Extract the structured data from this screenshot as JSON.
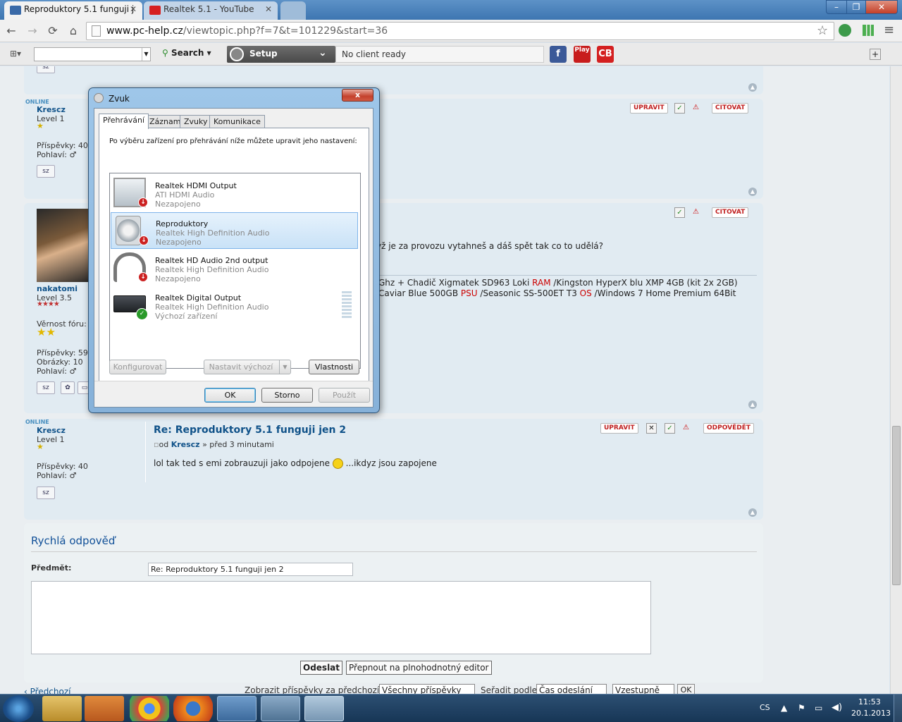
{
  "browser": {
    "tabs": [
      {
        "title": "Reproduktory 5.1 funguji j",
        "icon": "doc-icon",
        "active": true
      },
      {
        "title": "Realtek 5.1 - YouTube",
        "icon": "youtube-icon",
        "active": false
      }
    ],
    "close_glyph": "✕",
    "nav": {
      "back": "←",
      "forward": "→",
      "reload": "⟳",
      "home": "⌂"
    },
    "url": {
      "host": "www.pc-help.cz",
      "path": "/viewtopic.php?f=7&t=101229&start=36"
    },
    "window_buttons": {
      "minimize": "–",
      "restore": "❐",
      "close": "✕"
    },
    "star": "☆",
    "menu": "≡"
  },
  "extbar": {
    "search_value": "",
    "search_label": "Search",
    "ut_label": "Setup",
    "client_status": "No client ready",
    "buttons": [
      "f",
      "Play",
      "CB"
    ]
  },
  "posts": [
    {
      "status": "ONLINE",
      "user": "Krescz",
      "level": "Level 1",
      "stats": [
        "Příspěvky: 40",
        "Pohlaví: ♂"
      ],
      "pm": "sz",
      "actions": [
        "UPRAVIT",
        "CITOVAT"
      ]
    },
    {
      "user": "nakatomi",
      "level": "Level 3.5",
      "stats": [
        "Věrnost fóru:",
        "Příspěvky: 59",
        "Obrázky: 10",
        "Pohlaví: ♂"
      ],
      "pm": "sz",
      "text": "yž je za provozu vytahneš a dáš spět tak co to udělá?",
      "sig_line1": [
        "Ghz + Chadič Xigmatek SD963 Loki ",
        "RAM",
        " /Kingston HyperX blu XMP 4GB (kit 2x 2GB)"
      ],
      "sig_line2": [
        "Caviar Blue 500GB ",
        "PSU",
        " /Seasonic SS-500ET T3 ",
        "OS",
        " /Windows 7 Home Premium 64Bit"
      ],
      "actions": [
        "CITOVAT"
      ]
    },
    {
      "status": "ONLINE",
      "user": "Krescz",
      "level": "Level 1",
      "stats": [
        "Příspěvky: 40",
        "Pohlaví: ♂"
      ],
      "pm": "sz",
      "title": "Re: Reproduktory 5.1 funguji jen 2",
      "byline_pre": "od",
      "byline_user": "Krescz",
      "byline_post": " » před 3 minutami",
      "text_a": "lol tak ted s emi zobrauzuji jako odpojene",
      "text_b": "...ikdyz jsou zapojene",
      "actions": [
        "UPRAVIT",
        "ODPOVĚDĚT"
      ]
    }
  ],
  "quick_reply": {
    "heading": "Rychlá odpověď",
    "subject_label": "Předmět:",
    "subject_value": "Re: Reproduktory 5.1 funguji jen 2",
    "submit": "Odeslat",
    "full_editor": "Přepnout na plnohodnotný editor"
  },
  "footer": {
    "prev": "‹ Předchozí",
    "show_label": "Zobrazit příspěvky za předchozí:",
    "show_value": "Všechny příspěvky",
    "sort_label": "Seřadit podle",
    "sort_value": "Čas odeslání",
    "order_value": "Vzestupně",
    "go": "OK"
  },
  "dialog": {
    "title": "Zvuk",
    "close": "x",
    "tabs": [
      "Přehrávání",
      "Záznam",
      "Zvuky",
      "Komunikace"
    ],
    "instruction": "Po výběru zařízení pro přehrávání níže můžete upravit jeho nastavení:",
    "devices": [
      {
        "name": "Realtek HDMI Output",
        "desc": "ATI HDMI Audio",
        "state": "Nezapojeno",
        "icon": "monitor-icon",
        "selected": false
      },
      {
        "name": "Reproduktory",
        "desc": "Realtek High Definition Audio",
        "state": "Nezapojeno",
        "icon": "speaker-icon",
        "selected": true
      },
      {
        "name": "Realtek HD Audio 2nd output",
        "desc": "Realtek High Definition Audio",
        "state": "Nezapojeno",
        "icon": "headphones-icon",
        "selected": false
      },
      {
        "name": "Realtek Digital Output",
        "desc": "Realtek High Definition Audio",
        "state": "Výchozí zařízení",
        "icon": "receiver-icon",
        "selected": false
      }
    ],
    "configure": "Konfigurovat",
    "set_default": "Nastavit výchozí",
    "properties": "Vlastnosti",
    "ok": "OK",
    "cancel": "Storno",
    "apply": "Použít"
  },
  "taskbar": {
    "lang": "CS",
    "time": "11:53",
    "date": "20.1.2013"
  }
}
